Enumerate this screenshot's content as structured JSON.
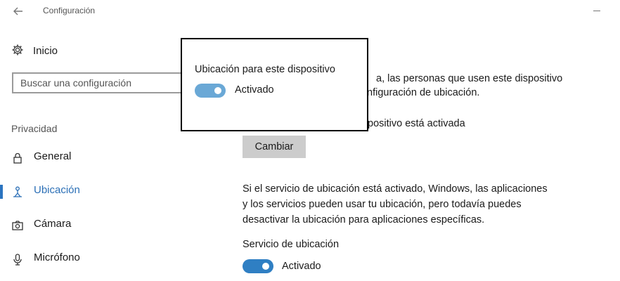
{
  "window": {
    "title": "Configuración"
  },
  "sidebar": {
    "home_label": "Inicio",
    "search_placeholder": "Buscar una configuración",
    "section_label": "Privacidad",
    "items": [
      {
        "label": "General",
        "icon": "lock-icon"
      },
      {
        "label": "Ubicación",
        "icon": "location-person-icon",
        "active": true
      },
      {
        "label": "Cámara",
        "icon": "camera-icon"
      },
      {
        "label": "Micrófono",
        "icon": "microphone-icon"
      }
    ]
  },
  "main": {
    "text_line1_partial": "a, las personas que usen este dispositivo",
    "text_line2_partial": "nfiguración de ubicación.",
    "status_partial": "positivo está activada",
    "change_button": "Cambiar",
    "description": "Si el servicio de ubicación está activado, Windows, las aplicaciones\ny los servicios pueden usar tu ubicación, pero todavía puedes\ndesactivar la ubicación para aplicaciones específicas.",
    "service_title": "Servicio de ubicación",
    "service_toggle_label": "Activado",
    "service_toggle_on": true
  },
  "popup": {
    "title": "Ubicación para este dispositivo",
    "toggle_label": "Activado",
    "toggle_on": true
  },
  "colors": {
    "accent": "#2b74c0",
    "toggle_on": "#2f7fc3",
    "toggle_popup": "#6aa8d6"
  }
}
